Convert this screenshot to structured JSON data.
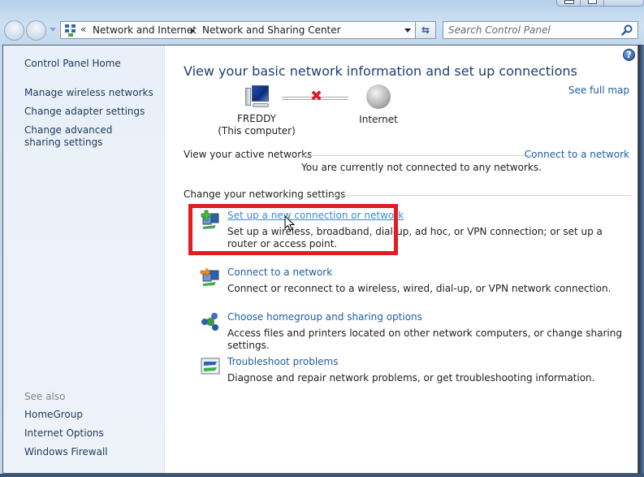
{
  "window": {
    "caption_buttons": [
      "minimize",
      "maximize",
      "close"
    ]
  },
  "nav": {
    "back_icon": "back-arrow-icon",
    "forward_icon": "forward-arrow-icon",
    "address": {
      "overflow_chevron": "«",
      "breadcrumbs": [
        "Network and Internet",
        "Network and Sharing Center"
      ]
    },
    "refresh_glyph": "⇆",
    "search": {
      "placeholder": "Search Control Panel",
      "value": ""
    }
  },
  "sidebar": {
    "home": "Control Panel Home",
    "tasks": [
      "Manage wireless networks",
      "Change adapter settings",
      "Change advanced sharing settings"
    ],
    "see_also_label": "See also",
    "see_also": [
      "HomeGroup",
      "Internet Options",
      "Windows Firewall"
    ]
  },
  "main": {
    "help_glyph": "?",
    "title": "View your basic network information and set up connections",
    "see_full_map": "See full map",
    "map": {
      "computer_name": "FREDDY",
      "computer_sub": "(This computer)",
      "connection_status": "disconnected",
      "x_glyph": "✖",
      "internet": "Internet"
    },
    "active_networks": {
      "label": "View your active networks",
      "connect_link": "Connect to a network",
      "status": "You are currently not connected to any networks."
    },
    "networking_settings": {
      "label": "Change your networking settings",
      "tasks": [
        {
          "title": "Set up a new connection or network",
          "desc": "Set up a wireless, broadband, dial-up, ad hoc, or VPN connection; or set up a router or access point.",
          "icon": "new-connection-icon",
          "highlighted": true
        },
        {
          "title": "Connect to a network",
          "desc": "Connect or reconnect to a wireless, wired, dial-up, or VPN network connection.",
          "icon": "connect-network-icon"
        },
        {
          "title": "Choose homegroup and sharing options",
          "desc": "Access files and printers located on other network computers, or change sharing settings.",
          "icon": "homegroup-icon"
        },
        {
          "title": "Troubleshoot problems",
          "desc": "Diagnose and repair network problems, or get troubleshooting information.",
          "icon": "troubleshoot-icon"
        }
      ]
    }
  },
  "colors": {
    "link": "#1d5ea6",
    "title": "#1e3e73",
    "highlight_box": "#e31b23",
    "sidebar_bg": "#eef3fa"
  }
}
